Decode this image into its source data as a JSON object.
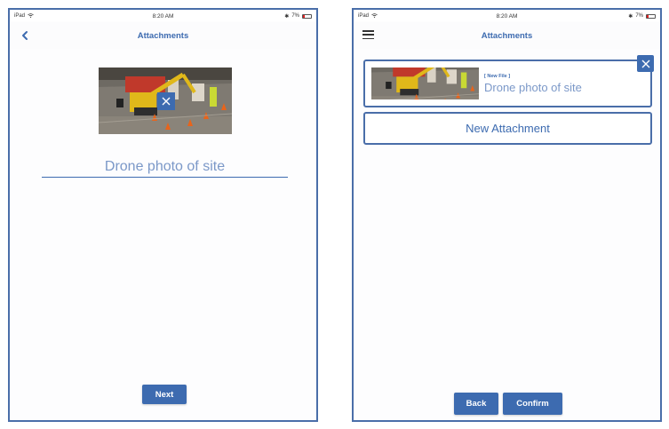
{
  "status_bar": {
    "carrier": "iPad",
    "time": "8:20 AM",
    "battery": "7%"
  },
  "left_screen": {
    "title": "Attachments",
    "caption_value": "Drone photo of site",
    "next_label": "Next"
  },
  "right_screen": {
    "title": "Attachments",
    "attachment": {
      "tag": "[ New File ]",
      "caption": "Drone photo of site"
    },
    "new_attachment_label": "New Attachment",
    "back_label": "Back",
    "confirm_label": "Confirm"
  },
  "colors": {
    "accent": "#3d6bb0",
    "border": "#4a6ea9",
    "caption": "#7b98c8"
  },
  "icons": [
    "back-chevron-icon",
    "menu-icon",
    "close-icon",
    "wifi-icon",
    "battery-icon"
  ]
}
